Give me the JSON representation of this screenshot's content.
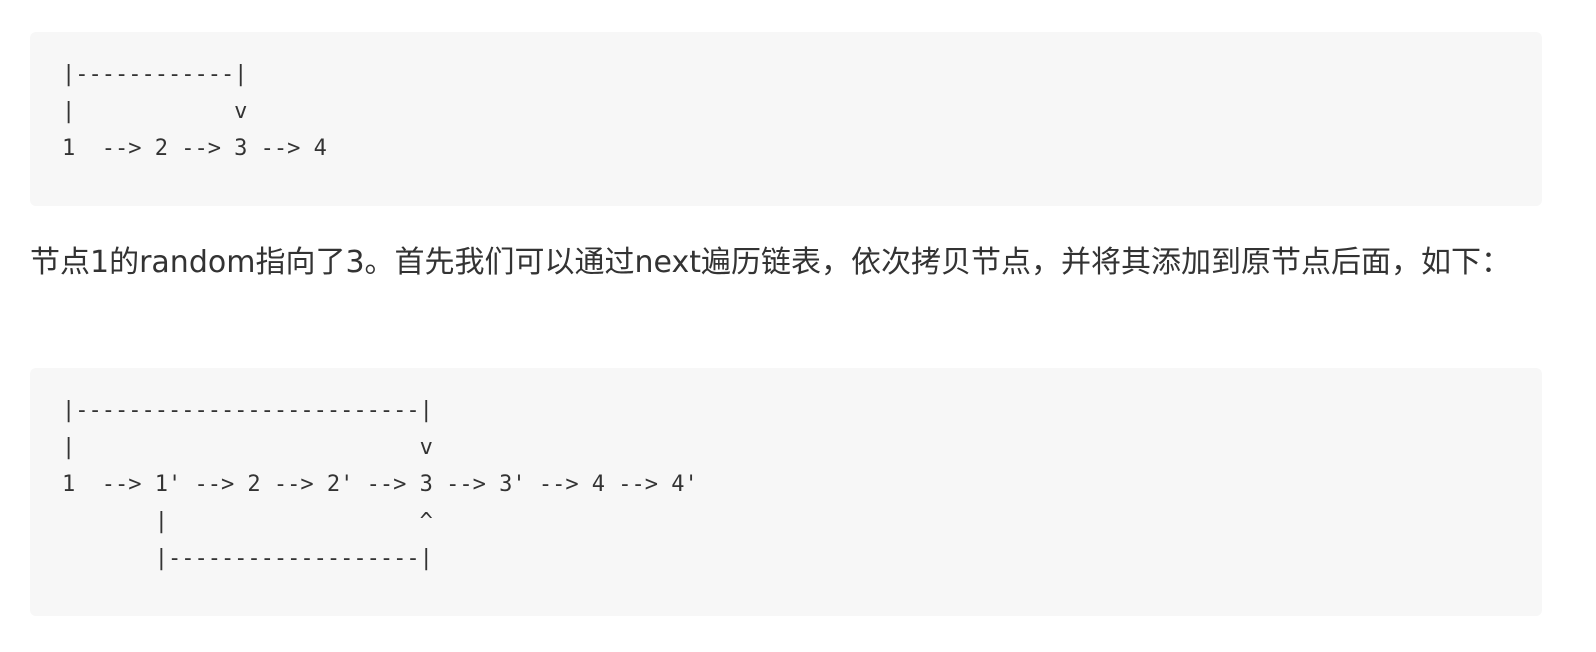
{
  "code_block_1": {
    "lines": "|------------|\n|            v\n1  --> 2 --> 3 --> 4"
  },
  "paragraph": {
    "text": "节点1的random指向了3。首先我们可以通过next遍历链表，依次拷贝节点，并将其添加到原节点后面，如下："
  },
  "code_block_2": {
    "lines": "|--------------------------|\n|                          v\n1  --> 1' --> 2 --> 2' --> 3 --> 3' --> 4 --> 4'\n       |                   ^\n       |-------------------|"
  }
}
